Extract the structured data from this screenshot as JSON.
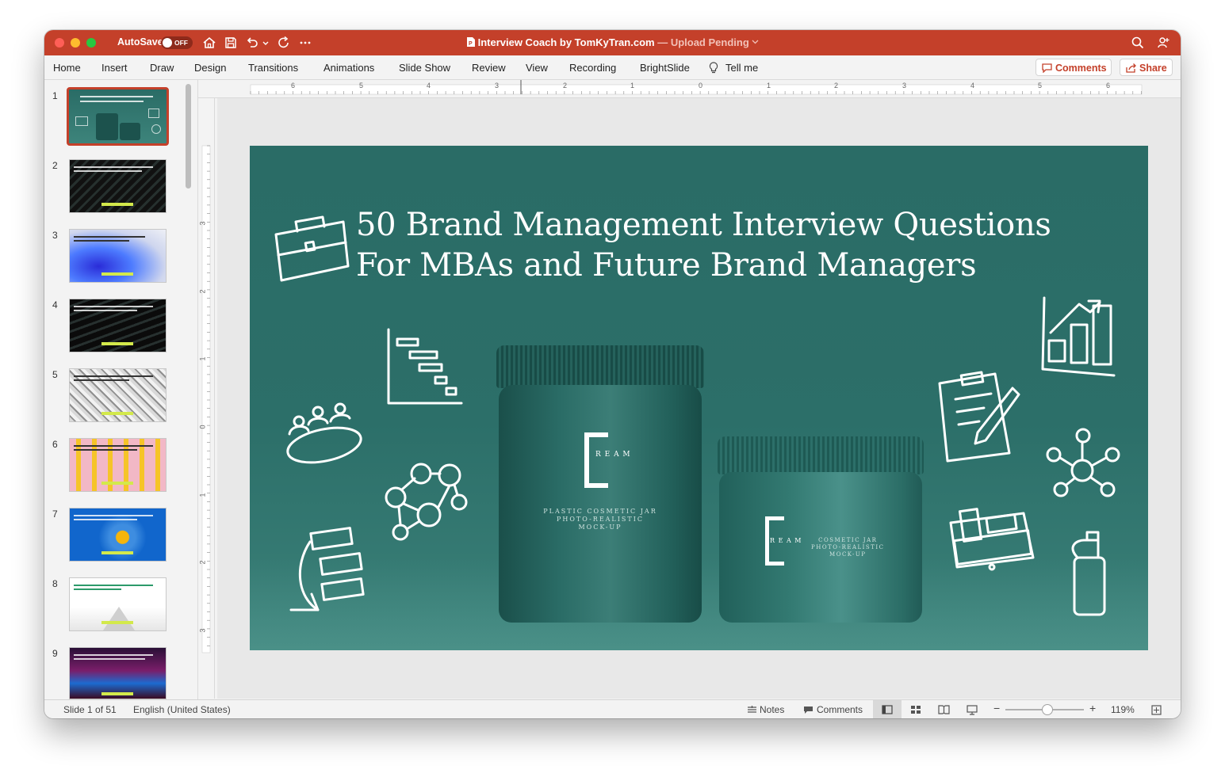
{
  "titlebar": {
    "autosave_label": "AutoSave",
    "autosave_state": "OFF",
    "doc_title": "Interview Coach by TomKyTran.com",
    "separator": " — ",
    "upload_status": "Upload Pending"
  },
  "ribbon": {
    "tabs": [
      "Home",
      "Insert",
      "Draw",
      "Design",
      "Transitions",
      "Animations",
      "Slide Show",
      "Review",
      "View",
      "Recording",
      "BrightSlide"
    ],
    "tell_me": "Tell me",
    "comments_label": "Comments",
    "share_label": "Share"
  },
  "ruler": {
    "h_labels": [
      "6",
      "5",
      "4",
      "3",
      "2",
      "1",
      "0",
      "1",
      "2",
      "3",
      "4",
      "5",
      "6"
    ],
    "v_labels": [
      "3",
      "2",
      "1",
      "0",
      "1",
      "2",
      "3"
    ]
  },
  "slides": [
    {
      "number": "1",
      "theme": "teal"
    },
    {
      "number": "2",
      "theme": "dark"
    },
    {
      "number": "3",
      "theme": "blue-swirl"
    },
    {
      "number": "4",
      "theme": "dark"
    },
    {
      "number": "5",
      "theme": "architecture"
    },
    {
      "number": "6",
      "theme": "pink-bananas"
    },
    {
      "number": "7",
      "theme": "blue-lemon"
    },
    {
      "number": "8",
      "theme": "white"
    },
    {
      "number": "9",
      "theme": "neon"
    }
  ],
  "slide": {
    "title_line1": "50 Brand Management Interview Questions",
    "title_line2": "For MBAs and Future Brand Managers",
    "jar_large_letter": "C",
    "jar_large_word": "R E A M",
    "jar_large_sub1": "PLASTIC COSMETIC JAR",
    "jar_large_sub2": "PHOTO-REALISTIC",
    "jar_large_sub3": "MOCK-UP",
    "jar_small_letter": "C",
    "jar_small_word": "R E A M",
    "jar_small_sub1": "COSMETIC JAR",
    "jar_small_sub2": "PHOTO-REALISTIC",
    "jar_small_sub3": "MOCK-UP"
  },
  "status": {
    "slide_info": "Slide 1 of 51",
    "language": "English (United States)",
    "notes_label": "Notes",
    "comments_label": "Comments",
    "zoom": "119%"
  },
  "colors": {
    "brand": "#c4402a",
    "slide_teal": "#2c6f69",
    "jar": "#1f5a55",
    "accent_lime": "#d3e94b"
  }
}
